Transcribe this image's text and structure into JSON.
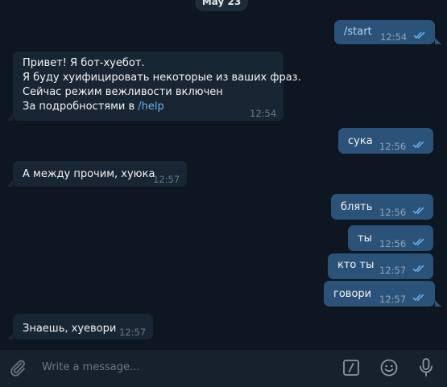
{
  "chat": {
    "date_label": "May 23",
    "messages": [
      {
        "dir": "out",
        "text": "/start",
        "time": "12:54",
        "status": "read"
      },
      {
        "dir": "in",
        "lines": [
          "Привет! Я бот-хуебот.",
          "Я буду хуифицировать некоторые из ваших фраз.",
          "Сейчас режим вежливости включен"
        ],
        "last_line_prefix": "За подробностями в ",
        "last_line_link": "/help",
        "time": "12:54"
      },
      {
        "dir": "out",
        "text": "сука",
        "time": "12:56",
        "status": "read"
      },
      {
        "dir": "in",
        "text": "А между прочим, хуюка",
        "time": "12:57"
      },
      {
        "dir": "out",
        "text": "блять",
        "time": "12:56",
        "status": "read"
      },
      {
        "dir": "out",
        "text": "ты",
        "time": "12:56",
        "status": "read"
      },
      {
        "dir": "out",
        "text": "кто ты",
        "time": "12:57",
        "status": "read"
      },
      {
        "dir": "out",
        "text": "говори",
        "time": "12:57",
        "status": "read"
      },
      {
        "dir": "in",
        "text": "Знаешь, хуевори",
        "time": "12:57"
      }
    ]
  },
  "input": {
    "placeholder": "Write a message..."
  },
  "icons": {
    "attach": "paperclip-icon",
    "commands": "slash-commands-icon",
    "emoji": "smiley-icon",
    "voice": "microphone-icon",
    "read_status": "double-check-icon"
  },
  "colors": {
    "background": "#0e1621",
    "outgoing_bubble": "#2b5278",
    "incoming_bubble": "#182533",
    "input_bar": "#17212b",
    "link": "#6ab3f3",
    "check": "#6ab3f3"
  }
}
